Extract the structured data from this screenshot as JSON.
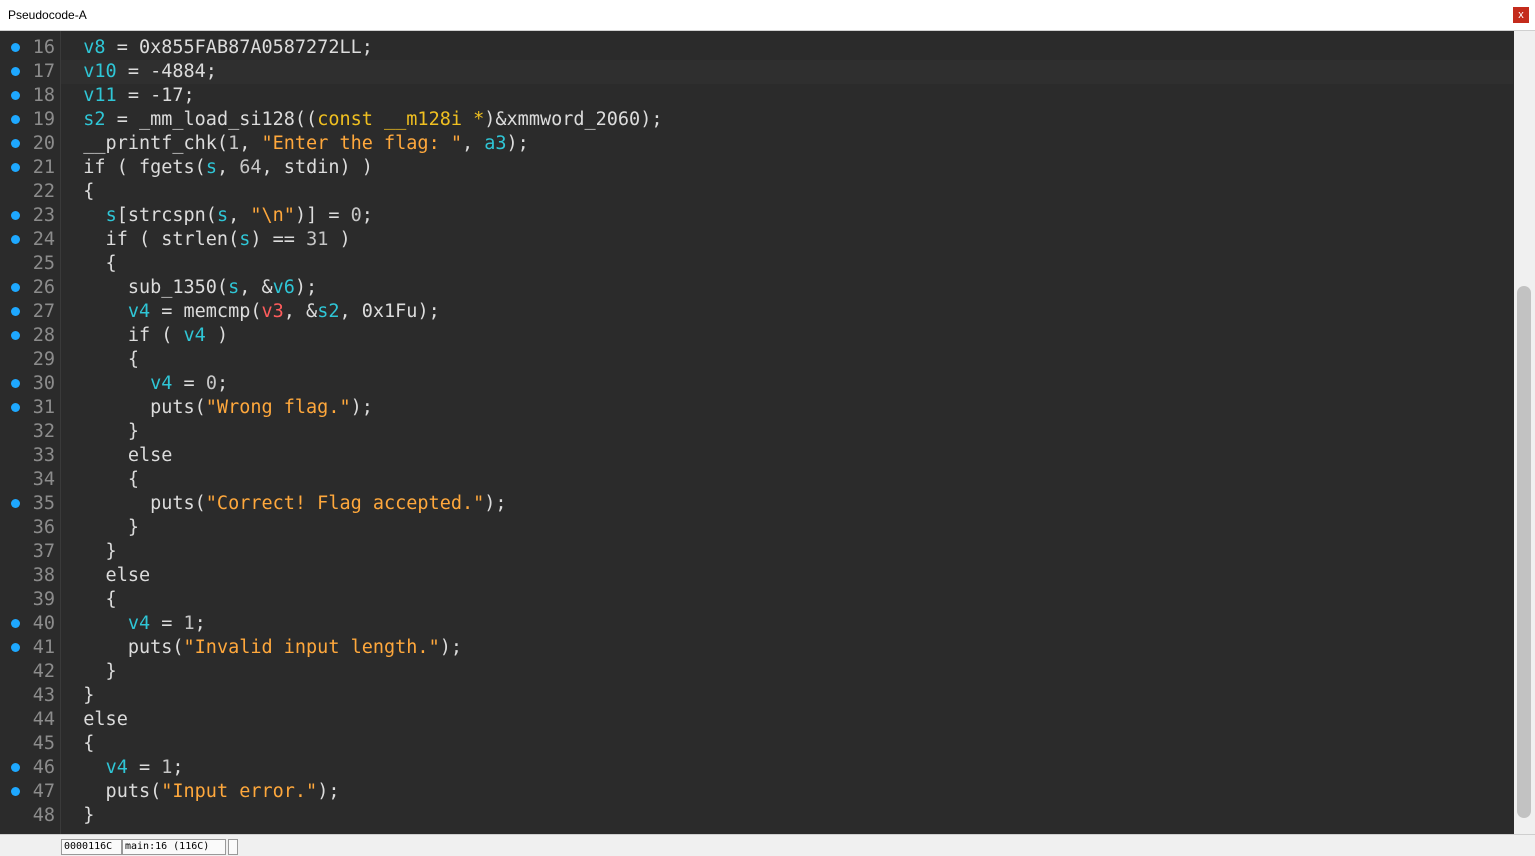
{
  "window": {
    "title": "Pseudocode-A",
    "close_label": "x"
  },
  "status": {
    "address": "0000116C",
    "location": "main:16 (116C)"
  },
  "colors": {
    "background": "#2b2b2b",
    "breakpoint_dot": "#1ea8ff",
    "string": "#ffa83c",
    "variable": "#2fc6d6",
    "type": "#f0c020",
    "error_var": "#ff5c5c"
  },
  "lines": [
    {
      "n": "16",
      "dot": true,
      "tokens": [
        [
          "  ",
          ""
        ],
        [
          "v8",
          "b"
        ],
        [
          " = 0x855FAB87A0587272LL;",
          "d"
        ]
      ]
    },
    {
      "n": "17",
      "dot": true,
      "tokens": [
        [
          "  ",
          ""
        ],
        [
          "v10",
          "b"
        ],
        [
          " = -4884;",
          "d"
        ]
      ]
    },
    {
      "n": "18",
      "dot": true,
      "tokens": [
        [
          "  ",
          ""
        ],
        [
          "v11",
          "b"
        ],
        [
          " = -17;",
          "d"
        ]
      ]
    },
    {
      "n": "19",
      "dot": true,
      "tokens": [
        [
          "  ",
          ""
        ],
        [
          "s2",
          "b"
        ],
        [
          " = _mm_load_si128((",
          "d"
        ],
        [
          "const __m128i *",
          "y"
        ],
        [
          ")&xmmword_2060);",
          "d"
        ]
      ]
    },
    {
      "n": "20",
      "dot": true,
      "tokens": [
        [
          "  ",
          ""
        ],
        [
          "__printf_chk(",
          "d"
        ],
        [
          "1",
          "n"
        ],
        [
          ", ",
          "d"
        ],
        [
          "\"Enter the flag: \"",
          "s"
        ],
        [
          ", ",
          "d"
        ],
        [
          "a3",
          "b"
        ],
        [
          ");",
          "d"
        ]
      ]
    },
    {
      "n": "21",
      "dot": true,
      "tokens": [
        [
          "  ",
          ""
        ],
        [
          "if ( fgets(",
          "d"
        ],
        [
          "s",
          "b"
        ],
        [
          ", ",
          "d"
        ],
        [
          "64",
          "n"
        ],
        [
          ", stdin) )",
          "d"
        ]
      ]
    },
    {
      "n": "22",
      "dot": false,
      "tokens": [
        [
          "  {",
          "d"
        ]
      ]
    },
    {
      "n": "23",
      "dot": true,
      "tokens": [
        [
          "    ",
          ""
        ],
        [
          "s",
          "b"
        ],
        [
          "[strcspn(",
          "d"
        ],
        [
          "s",
          "b"
        ],
        [
          ", ",
          "d"
        ],
        [
          "\"\\n\"",
          "s"
        ],
        [
          ")] = ",
          "d"
        ],
        [
          "0",
          "n"
        ],
        [
          ";",
          "d"
        ]
      ]
    },
    {
      "n": "24",
      "dot": true,
      "tokens": [
        [
          "    if ( strlen(",
          "d"
        ],
        [
          "s",
          "b"
        ],
        [
          ") == ",
          "d"
        ],
        [
          "31",
          "n"
        ],
        [
          " )",
          "d"
        ]
      ]
    },
    {
      "n": "25",
      "dot": false,
      "tokens": [
        [
          "    {",
          "d"
        ]
      ]
    },
    {
      "n": "26",
      "dot": true,
      "tokens": [
        [
          "      sub_1350(",
          "d"
        ],
        [
          "s",
          "b"
        ],
        [
          ", &",
          "d"
        ],
        [
          "v6",
          "b"
        ],
        [
          ");",
          "d"
        ]
      ]
    },
    {
      "n": "27",
      "dot": true,
      "tokens": [
        [
          "      ",
          ""
        ],
        [
          "v4",
          "b"
        ],
        [
          " = memcmp(",
          "d"
        ],
        [
          "v3",
          "r"
        ],
        [
          ", &",
          "d"
        ],
        [
          "s2",
          "b"
        ],
        [
          ", 0x1Fu);",
          "d"
        ]
      ]
    },
    {
      "n": "28",
      "dot": true,
      "tokens": [
        [
          "      if ( ",
          "d"
        ],
        [
          "v4",
          "b"
        ],
        [
          " )",
          "d"
        ]
      ]
    },
    {
      "n": "29",
      "dot": false,
      "tokens": [
        [
          "      {",
          "d"
        ]
      ]
    },
    {
      "n": "30",
      "dot": true,
      "tokens": [
        [
          "        ",
          ""
        ],
        [
          "v4",
          "b"
        ],
        [
          " = ",
          "d"
        ],
        [
          "0",
          "n"
        ],
        [
          ";",
          "d"
        ]
      ]
    },
    {
      "n": "31",
      "dot": true,
      "tokens": [
        [
          "        puts(",
          "d"
        ],
        [
          "\"Wrong flag.\"",
          "s"
        ],
        [
          ");",
          "d"
        ]
      ]
    },
    {
      "n": "32",
      "dot": false,
      "tokens": [
        [
          "      }",
          "d"
        ]
      ]
    },
    {
      "n": "33",
      "dot": false,
      "tokens": [
        [
          "      else",
          "d"
        ]
      ]
    },
    {
      "n": "34",
      "dot": false,
      "tokens": [
        [
          "      {",
          "d"
        ]
      ]
    },
    {
      "n": "35",
      "dot": true,
      "tokens": [
        [
          "        puts(",
          "d"
        ],
        [
          "\"Correct! Flag accepted.\"",
          "s"
        ],
        [
          ");",
          "d"
        ]
      ]
    },
    {
      "n": "36",
      "dot": false,
      "tokens": [
        [
          "      }",
          "d"
        ]
      ]
    },
    {
      "n": "37",
      "dot": false,
      "tokens": [
        [
          "    }",
          "d"
        ]
      ]
    },
    {
      "n": "38",
      "dot": false,
      "tokens": [
        [
          "    else",
          "d"
        ]
      ]
    },
    {
      "n": "39",
      "dot": false,
      "tokens": [
        [
          "    {",
          "d"
        ]
      ]
    },
    {
      "n": "40",
      "dot": true,
      "tokens": [
        [
          "      ",
          ""
        ],
        [
          "v4",
          "b"
        ],
        [
          " = ",
          "d"
        ],
        [
          "1",
          "n"
        ],
        [
          ";",
          "d"
        ]
      ]
    },
    {
      "n": "41",
      "dot": true,
      "tokens": [
        [
          "      puts(",
          "d"
        ],
        [
          "\"Invalid input length.\"",
          "s"
        ],
        [
          ");",
          "d"
        ]
      ]
    },
    {
      "n": "42",
      "dot": false,
      "tokens": [
        [
          "    }",
          "d"
        ]
      ]
    },
    {
      "n": "43",
      "dot": false,
      "tokens": [
        [
          "  }",
          "d"
        ]
      ]
    },
    {
      "n": "44",
      "dot": false,
      "tokens": [
        [
          "  else",
          "d"
        ]
      ]
    },
    {
      "n": "45",
      "dot": false,
      "tokens": [
        [
          "  {",
          "d"
        ]
      ]
    },
    {
      "n": "46",
      "dot": true,
      "tokens": [
        [
          "    ",
          ""
        ],
        [
          "v4",
          "b"
        ],
        [
          " = ",
          "d"
        ],
        [
          "1",
          "n"
        ],
        [
          ";",
          "d"
        ]
      ]
    },
    {
      "n": "47",
      "dot": true,
      "tokens": [
        [
          "    puts(",
          "d"
        ],
        [
          "\"Input error.\"",
          "s"
        ],
        [
          ");",
          "d"
        ]
      ]
    },
    {
      "n": "48",
      "dot": false,
      "tokens": [
        [
          "  }",
          "d"
        ]
      ]
    }
  ]
}
